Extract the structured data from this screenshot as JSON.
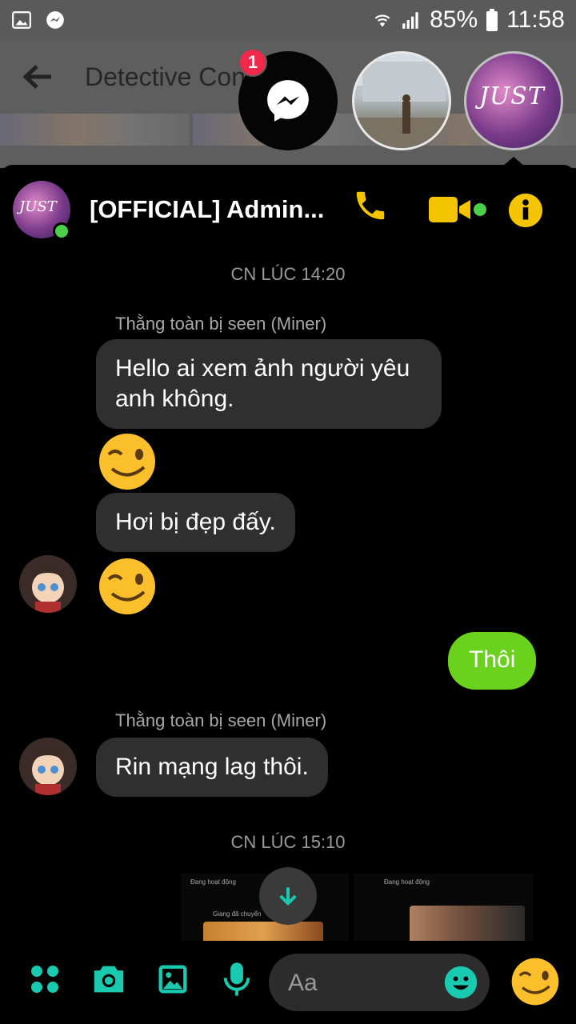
{
  "status_bar": {
    "battery": "85%",
    "time": "11:58"
  },
  "background_app": {
    "title": "Detective Conan Ar"
  },
  "chat_heads": {
    "badge_count": "1",
    "album_text": "JUST"
  },
  "chat": {
    "name": "[OFFICIAL] Admin...",
    "avatar_text": "JUST"
  },
  "messages": {
    "timestamp_1": "CN LÚC 14:20",
    "sender_1": "Thằng toàn bị seen (Miner)",
    "msg_1_line1": "Hello ai xem ảnh người yêu",
    "msg_1_line2": "anh không.",
    "msg_2": "Hơi bị đẹp đấy.",
    "my_msg": "Thôi",
    "sender_2": "Thằng toàn bị seen (Miner)",
    "msg_3": "Rin mạng lag thôi.",
    "timestamp_2": "CN LÚC 15:10"
  },
  "shared_image": {
    "left_status": "Đang hoạt động",
    "left_caption": "Giang đã chuyển",
    "right_status": "Đang hoạt động"
  },
  "composer": {
    "placeholder": "Aa"
  },
  "colors": {
    "accent": "#f5c400",
    "green": "#6ad11d",
    "teal": "#19c9b0",
    "online": "#4cd04c"
  }
}
